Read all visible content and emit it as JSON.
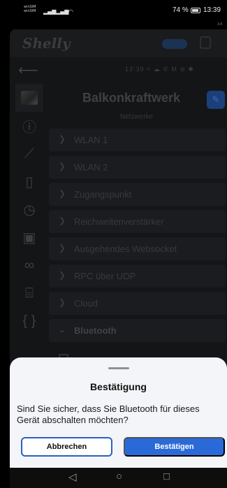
{
  "status_bar": {
    "sim1": "winSIM",
    "sim2": "winSIM",
    "battery": "74 %",
    "time": "13:39",
    "right_edge": "3.4"
  },
  "app": {
    "brand": "Shelly",
    "nav_status": "13:39 < ☁ ✆ M ⊜ ✱",
    "device_name": "Balkonkraftwerk",
    "section_title": "Netzwerke"
  },
  "rail": {
    "icons": [
      "device-avatar",
      "info-icon",
      "chart-icon",
      "document-icon",
      "clock-icon",
      "calendar-icon",
      "link-icon",
      "trash-icon",
      "code-braces-icon"
    ]
  },
  "accordions": [
    {
      "label": "WLAN 1",
      "open": false
    },
    {
      "label": "WLAN 2",
      "open": false
    },
    {
      "label": "Zugangspunkt",
      "open": false
    },
    {
      "label": "Reichweitenverstärker",
      "open": false
    },
    {
      "label": "Ausgehendes Websocket",
      "open": false
    },
    {
      "label": "RPC über UDP",
      "open": false
    },
    {
      "label": "Cloud",
      "open": false
    },
    {
      "label": "Bluetooth",
      "open": true
    }
  ],
  "dialog": {
    "title": "Bestätigung",
    "message": "Sind Sie sicher, dass Sie Bluetooth für dieses Gerät abschalten möchten?",
    "cancel_label": "Abbrechen",
    "confirm_label": "Bestätigen"
  },
  "system_nav": {
    "back": "◁",
    "home": "○",
    "recents": "□"
  },
  "colors": {
    "accent": "#2a6ad8",
    "dialog_bg": "#f4f5f8"
  }
}
